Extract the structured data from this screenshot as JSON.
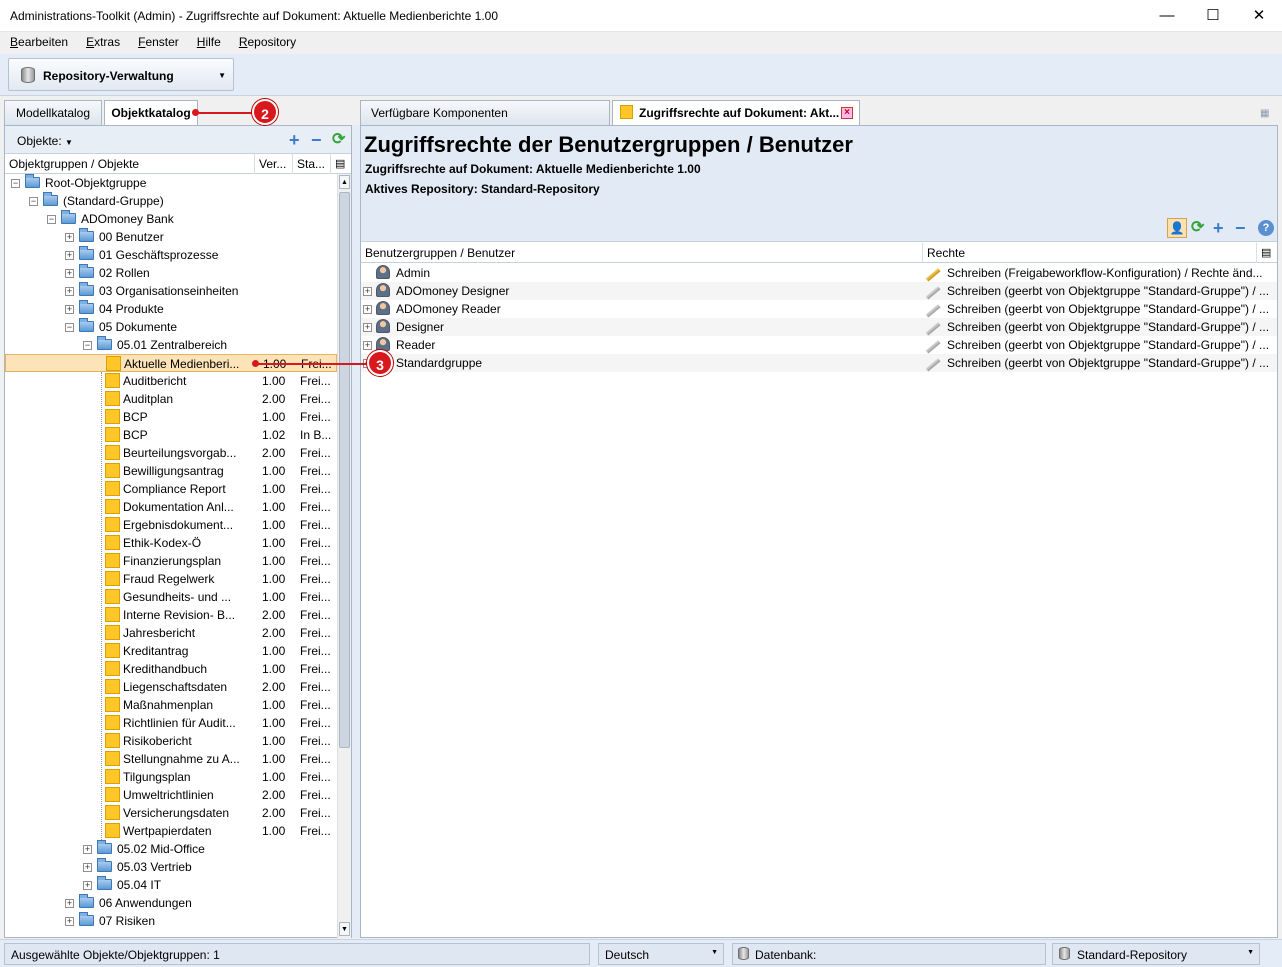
{
  "window": {
    "title": "Administrations-Toolkit (Admin) - Zugriffsrechte auf Dokument: Aktuelle Medienberichte 1.00",
    "minimize": "—",
    "maximize": "☐",
    "close": "✕"
  },
  "menu": [
    "Bearbeiten",
    "Extras",
    "Fenster",
    "Hilfe",
    "Repository"
  ],
  "toolbar": {
    "repository_button": "Repository-Verwaltung"
  },
  "left": {
    "tabs": [
      "Modellkatalog",
      "Objektkatalog"
    ],
    "active_tab": "Objektkatalog",
    "objects_label": "Objekte:",
    "columns": [
      "Objektgruppen / Objekte",
      "Ver...",
      "Sta..."
    ],
    "tree": [
      {
        "label": "Root-Objektgruppe",
        "type": "folder",
        "expander": "−",
        "version": "",
        "status": ""
      },
      {
        "label": "(Standard-Gruppe)",
        "type": "folder",
        "expander": "−",
        "version": "",
        "status": ""
      },
      {
        "label": "ADOmoney Bank",
        "type": "folder",
        "expander": "−",
        "version": "",
        "status": ""
      },
      {
        "label": "00 Benutzer",
        "type": "folder",
        "expander": "+",
        "version": "",
        "status": ""
      },
      {
        "label": "01 Geschäftsprozesse",
        "type": "folder",
        "expander": "+",
        "version": "",
        "status": ""
      },
      {
        "label": "02 Rollen",
        "type": "folder",
        "expander": "+",
        "version": "",
        "status": ""
      },
      {
        "label": "03 Organisationseinheiten",
        "type": "folder",
        "expander": "+",
        "version": "",
        "status": ""
      },
      {
        "label": "04 Produkte",
        "type": "folder",
        "expander": "+",
        "version": "",
        "status": ""
      },
      {
        "label": "05 Dokumente",
        "type": "folder",
        "expander": "−",
        "version": "",
        "status": ""
      },
      {
        "label": "05.01 Zentralbereich",
        "type": "folder",
        "expander": "−",
        "version": "",
        "status": ""
      },
      {
        "label": "Aktuelle Medienberi...",
        "type": "doc",
        "expander": "",
        "version": "1.00",
        "status": "Frei..."
      },
      {
        "label": "Auditbericht",
        "type": "doc",
        "expander": "",
        "version": "1.00",
        "status": "Frei..."
      },
      {
        "label": "Auditplan",
        "type": "doc",
        "expander": "",
        "version": "2.00",
        "status": "Frei..."
      },
      {
        "label": "BCP",
        "type": "doc",
        "expander": "",
        "version": "1.00",
        "status": "Frei..."
      },
      {
        "label": "BCP",
        "type": "doc",
        "expander": "",
        "version": "1.02",
        "status": "In B..."
      },
      {
        "label": "Beurteilungsvorgab...",
        "type": "doc",
        "expander": "",
        "version": "2.00",
        "status": "Frei..."
      },
      {
        "label": "Bewilligungsantrag",
        "type": "doc",
        "expander": "",
        "version": "1.00",
        "status": "Frei..."
      },
      {
        "label": "Compliance Report",
        "type": "doc",
        "expander": "",
        "version": "1.00",
        "status": "Frei..."
      },
      {
        "label": "Dokumentation Anl...",
        "type": "doc",
        "expander": "",
        "version": "1.00",
        "status": "Frei..."
      },
      {
        "label": "Ergebnisdokument...",
        "type": "doc",
        "expander": "",
        "version": "1.00",
        "status": "Frei..."
      },
      {
        "label": "Ethik-Kodex-Ö",
        "type": "doc",
        "expander": "",
        "version": "1.00",
        "status": "Frei..."
      },
      {
        "label": "Finanzierungsplan",
        "type": "doc",
        "expander": "",
        "version": "1.00",
        "status": "Frei..."
      },
      {
        "label": "Fraud Regelwerk",
        "type": "doc",
        "expander": "",
        "version": "1.00",
        "status": "Frei..."
      },
      {
        "label": "Gesundheits- und ...",
        "type": "doc",
        "expander": "",
        "version": "1.00",
        "status": "Frei..."
      },
      {
        "label": "Interne Revision- B...",
        "type": "doc",
        "expander": "",
        "version": "2.00",
        "status": "Frei..."
      },
      {
        "label": "Jahresbericht",
        "type": "doc",
        "expander": "",
        "version": "2.00",
        "status": "Frei..."
      },
      {
        "label": "Kreditantrag",
        "type": "doc",
        "expander": "",
        "version": "1.00",
        "status": "Frei..."
      },
      {
        "label": "Kredithandbuch",
        "type": "doc",
        "expander": "",
        "version": "1.00",
        "status": "Frei..."
      },
      {
        "label": "Liegenschaftsdaten",
        "type": "doc",
        "expander": "",
        "version": "2.00",
        "status": "Frei..."
      },
      {
        "label": "Maßnahmenplan",
        "type": "doc",
        "expander": "",
        "version": "1.00",
        "status": "Frei..."
      },
      {
        "label": "Richtlinien für Audit...",
        "type": "doc",
        "expander": "",
        "version": "1.00",
        "status": "Frei..."
      },
      {
        "label": "Risikobericht",
        "type": "doc",
        "expander": "",
        "version": "1.00",
        "status": "Frei..."
      },
      {
        "label": "Stellungnahme zu A...",
        "type": "doc",
        "expander": "",
        "version": "1.00",
        "status": "Frei..."
      },
      {
        "label": "Tilgungsplan",
        "type": "doc",
        "expander": "",
        "version": "1.00",
        "status": "Frei..."
      },
      {
        "label": "Umweltrichtlinien",
        "type": "doc",
        "expander": "",
        "version": "2.00",
        "status": "Frei..."
      },
      {
        "label": "Versicherungsdaten",
        "type": "doc",
        "expander": "",
        "version": "2.00",
        "status": "Frei..."
      },
      {
        "label": "Wertpapierdaten",
        "type": "doc",
        "expander": "",
        "version": "1.00",
        "status": "Frei..."
      },
      {
        "label": "05.02 Mid-Office",
        "type": "folder",
        "expander": "+",
        "version": "",
        "status": ""
      },
      {
        "label": "05.03 Vertrieb",
        "type": "folder",
        "expander": "+",
        "version": "",
        "status": ""
      },
      {
        "label": "05.04 IT",
        "type": "folder",
        "expander": "+",
        "version": "",
        "status": ""
      },
      {
        "label": "06 Anwendungen",
        "type": "folder",
        "expander": "+",
        "version": "",
        "status": ""
      },
      {
        "label": "07 Risiken",
        "type": "folder",
        "expander": "+",
        "version": "",
        "status": ""
      }
    ]
  },
  "right": {
    "tabs": [
      "Verfügbare Komponenten",
      "Zugriffsrechte auf Dokument: Akt..."
    ],
    "heading": "Zugriffsrechte der Benutzergruppen / Benutzer",
    "doc_line": "Zugriffsrechte auf Dokument: Aktuelle Medienberichte 1.00",
    "repo_line": "Aktives Repository:  Standard-Repository",
    "columns": [
      "Benutzergruppen / Benutzer",
      "Rechte"
    ],
    "rows": [
      {
        "name": "Admin",
        "expandable": false,
        "rights": "Schreiben (Freigabeworkflow-Konfiguration) / Rechte änd..."
      },
      {
        "name": "ADOmoney Designer",
        "expandable": true,
        "rights": "Schreiben (geerbt von Objektgruppe \"Standard-Gruppe\") / ..."
      },
      {
        "name": "ADOmoney Reader",
        "expandable": true,
        "rights": "Schreiben (geerbt von Objektgruppe \"Standard-Gruppe\") / ..."
      },
      {
        "name": "Designer",
        "expandable": true,
        "rights": "Schreiben (geerbt von Objektgruppe \"Standard-Gruppe\") / ..."
      },
      {
        "name": "Reader",
        "expandable": true,
        "rights": "Schreiben (geerbt von Objektgruppe \"Standard-Gruppe\") / ..."
      },
      {
        "name": "Standardgruppe",
        "expandable": true,
        "rights": "Schreiben (geerbt von Objektgruppe \"Standard-Gruppe\") / ..."
      }
    ]
  },
  "status": {
    "selected": "Ausgewählte Objekte/Objektgruppen: 1",
    "language": "Deutsch",
    "database_label": "Datenbank:",
    "repository": "Standard-Repository"
  },
  "callouts": [
    "2",
    "3"
  ],
  "colors": {
    "accent_red": "#d9181d",
    "selection": "#fde3b8",
    "doc_yellow": "#ffc627",
    "panel_blue": "#e2ebf5"
  }
}
